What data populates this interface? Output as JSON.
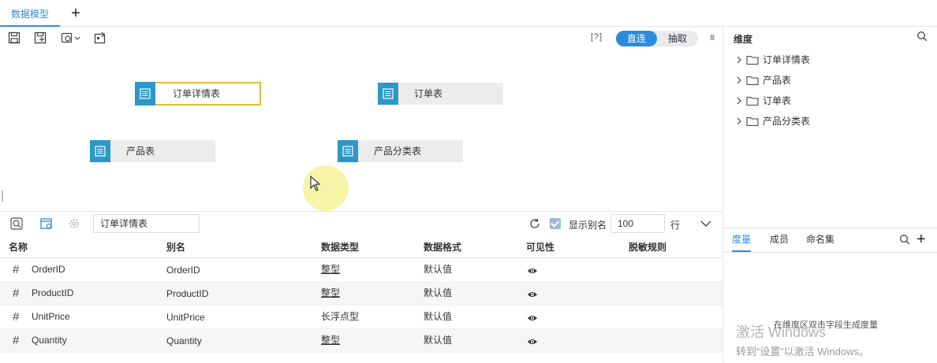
{
  "tabs": {
    "active_label": "数据模型",
    "add_label": "+"
  },
  "toolbar": {
    "help_label": "[?]",
    "mode_direct": "直连",
    "mode_extract": "抽取",
    "panel_handle": "III"
  },
  "canvas": {
    "tables": [
      {
        "label": "订单详情表",
        "selected": true
      },
      {
        "label": "订单表",
        "selected": false
      },
      {
        "label": "产品表",
        "selected": false
      },
      {
        "label": "产品分类表",
        "selected": false
      }
    ]
  },
  "field_bar": {
    "table_name": "订单详情表",
    "show_alias_label": "显示别名",
    "show_alias_checked": true,
    "rows_value": "100",
    "rows_unit": "行"
  },
  "grid": {
    "headers": [
      "名称",
      "别名",
      "数据类型",
      "数据格式",
      "可见性",
      "脱敏规则"
    ],
    "rows": [
      {
        "type_symbol": "#",
        "name": "OrderID",
        "alias": "OrderID",
        "data_type": "整型",
        "format": "默认值"
      },
      {
        "type_symbol": "#",
        "name": "ProductID",
        "alias": "ProductID",
        "data_type": "整型",
        "format": "默认值"
      },
      {
        "type_symbol": "#",
        "name": "UnitPrice",
        "alias": "UnitPrice",
        "data_type": "长浮点型",
        "format": "默认值"
      },
      {
        "type_symbol": "#",
        "name": "Quantity",
        "alias": "Quantity",
        "data_type": "整型",
        "format": "默认值"
      }
    ]
  },
  "right_panel": {
    "dimension_title": "维度",
    "tree": [
      "订单详情表",
      "产品表",
      "订单表",
      "产品分类表"
    ],
    "bottom_tabs": [
      "度量",
      "成员",
      "命名集"
    ],
    "bottom_add": "+",
    "hint_text": "在维度区双击字段生成度量",
    "watermark_line1": "激活 Windows",
    "watermark_line2": "转到“设置”以激活 Windows。"
  },
  "colors": {
    "accent": "#2e8bd8",
    "node_icon": "#2b98c8",
    "selected_border": "#e6b93a"
  }
}
